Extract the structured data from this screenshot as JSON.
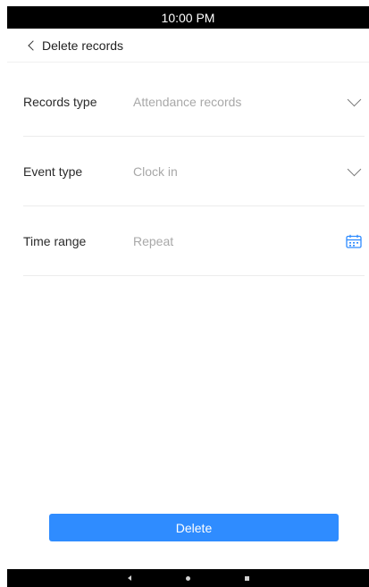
{
  "status_bar": {
    "time": "10:00 PM"
  },
  "header": {
    "title": "Delete records"
  },
  "form": {
    "records_type": {
      "label": "Records type",
      "value": "Attendance records",
      "icon": "chevron-down-icon"
    },
    "event_type": {
      "label": "Event type",
      "value": "Clock in",
      "icon": "chevron-down-icon"
    },
    "time_range": {
      "label": "Time range",
      "value": "Repeat",
      "icon": "calendar-icon"
    }
  },
  "actions": {
    "delete_label": "Delete"
  },
  "colors": {
    "accent": "#2f8cff",
    "label": "#2a2a2a",
    "value": "#a8a8a8"
  }
}
